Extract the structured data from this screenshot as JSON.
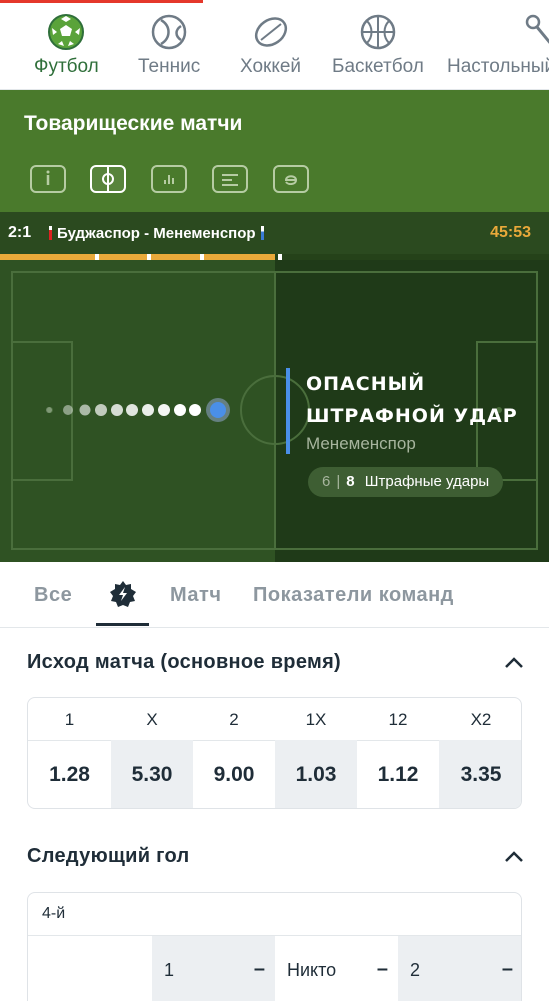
{
  "sports": [
    {
      "label": "Футбол",
      "icon": "football-icon",
      "active": true
    },
    {
      "label": "Теннис",
      "icon": "tennis-icon",
      "active": false
    },
    {
      "label": "Хоккей",
      "icon": "hockey-icon",
      "active": false
    },
    {
      "label": "Баскетбол",
      "icon": "basketball-icon",
      "active": false
    },
    {
      "label": "Настольный",
      "icon": "table-tennis-icon",
      "active": false
    }
  ],
  "header": {
    "title": "Товарищеские матчи",
    "view_buttons": [
      "info-icon",
      "field-icon",
      "stats-icon",
      "list-icon",
      "e-icon"
    ]
  },
  "match": {
    "score": "2:1",
    "teams": "Буджаспор - Менеменспор",
    "time": "45:53",
    "progress": 0.5
  },
  "event": {
    "line1": "ОПАСНЫЙ",
    "line2": "ШТРАФНОЙ УДАР",
    "team": "Менеменспор",
    "stat_home": "6",
    "stat_away": "8",
    "stat_label": "Штрафные удары"
  },
  "tabs": {
    "all": "Все",
    "match": "Матч",
    "team_stats": "Показатели команд"
  },
  "market1": {
    "title": "Исход матча (основное время)",
    "labels": [
      "1",
      "X",
      "2",
      "1X",
      "12",
      "X2"
    ],
    "values": [
      "1.28",
      "5.30",
      "9.00",
      "1.03",
      "1.12",
      "3.35"
    ]
  },
  "market2": {
    "title": "Следующий гол",
    "sub": "4-й",
    "opt1": "1",
    "opt2": "Никто",
    "opt3": "2",
    "dash": "–"
  },
  "colors": {
    "green_header": "#4a7a2c",
    "accent_orange": "#e9a93a",
    "accent_blue": "#4a8fe8"
  }
}
